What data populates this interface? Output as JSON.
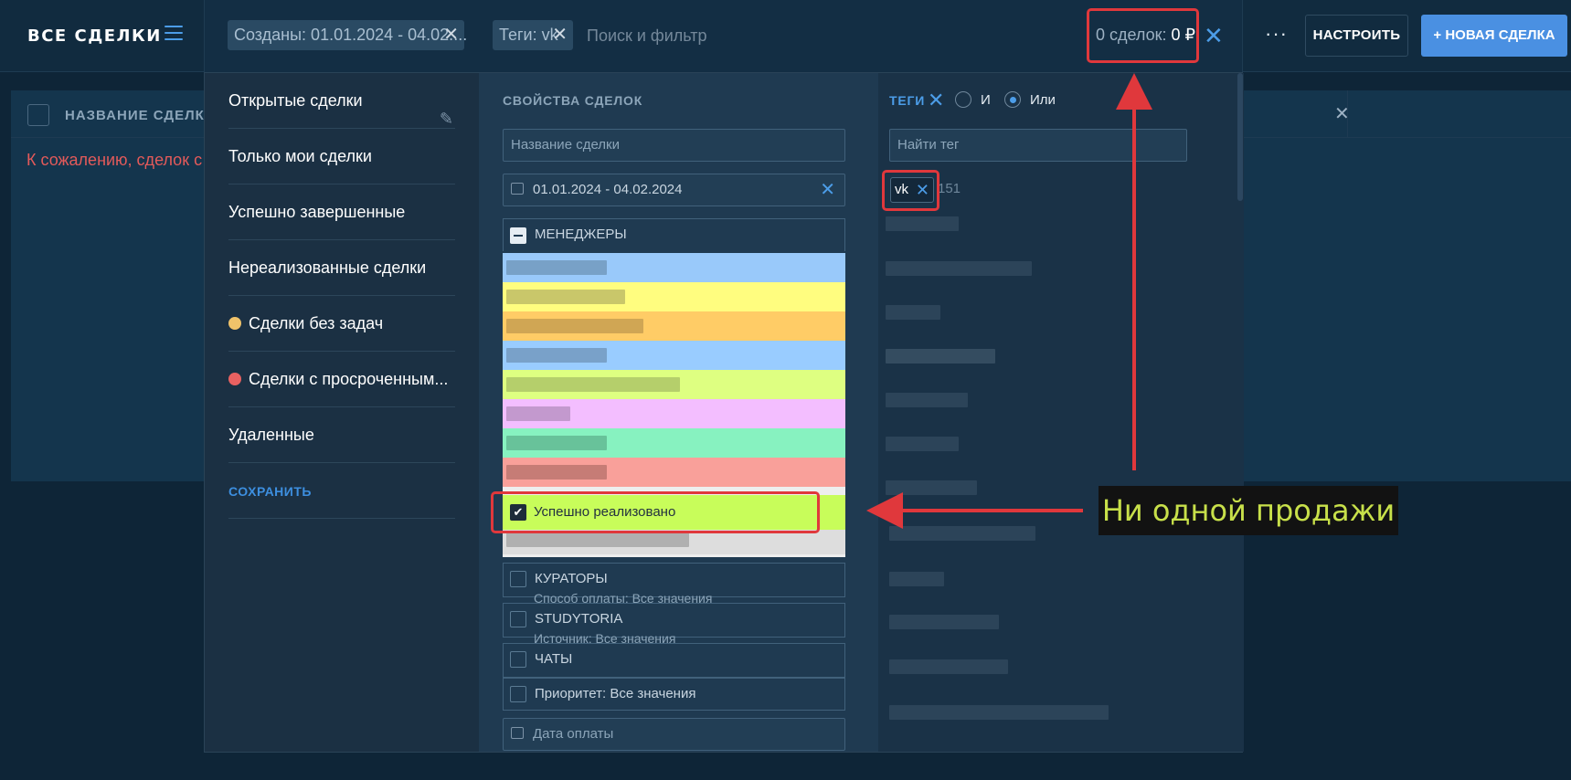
{
  "header": {
    "title": "ВСЕ СДЕЛКИ",
    "chips": [
      {
        "label": "Созданы: 01.01.2024 - 04.02...."
      },
      {
        "label": "Теги: vk"
      }
    ],
    "search_placeholder": "Поиск и фильтр",
    "summary_count": "0 сделок:",
    "summary_sum": "0 ₽",
    "more_label": "···",
    "setup_label": "НАСТРОИТЬ",
    "new_deal_label": "+ НОВАЯ СДЕЛКА"
  },
  "list": {
    "column_name": "НАЗВАНИЕ СДЕЛКИ",
    "empty_message": "К сожалению, сделок с п"
  },
  "presets": {
    "items": [
      {
        "label": "Открытые сделки",
        "dot": ""
      },
      {
        "label": "Только мои сделки",
        "dot": ""
      },
      {
        "label": "Успешно завершенные",
        "dot": ""
      },
      {
        "label": "Нереализованные сделки",
        "dot": ""
      },
      {
        "label": "Сделки без задач",
        "dot": "#f0c36a"
      },
      {
        "label": "Сделки с просроченным...",
        "dot": "#e96161"
      },
      {
        "label": "Удаленные",
        "dot": ""
      }
    ],
    "save_label": "СОХРАНИТЬ"
  },
  "properties": {
    "title": "СВОЙСТВА СДЕЛОК",
    "deal_name_placeholder": "Название сделки",
    "date_range": "01.01.2024 - 04.02.2024",
    "managers_label": "МЕНЕДЖЕРЫ",
    "success_status": "Успешно реализовано",
    "pipelines": [
      {
        "label": "КУРАТОРЫ",
        "sub": "Способ оплаты: Все значения"
      },
      {
        "label": "STUDYTORIA",
        "sub": "Источник: Все значения"
      },
      {
        "label": "ЧАТЫ",
        "sub": ""
      }
    ],
    "priority_label": "Приоритет: Все значения",
    "payment_date_placeholder": "Дата оплаты",
    "status_colors": [
      "#99c9fa",
      "#fffd7f",
      "#ffcc66",
      "#99ccff",
      "#deff81",
      "#f3beff",
      "#87f2c0",
      "#f9a09a",
      "#c8fd5a",
      "#dddddd"
    ]
  },
  "tags": {
    "title": "ТЕГИ",
    "logic_and": "И",
    "logic_or": "Или",
    "search_placeholder": "Найти тег",
    "selected_tag": "vk",
    "selected_tag_count": "151"
  },
  "annotation": {
    "callout_text": "Ни одной продажи"
  }
}
